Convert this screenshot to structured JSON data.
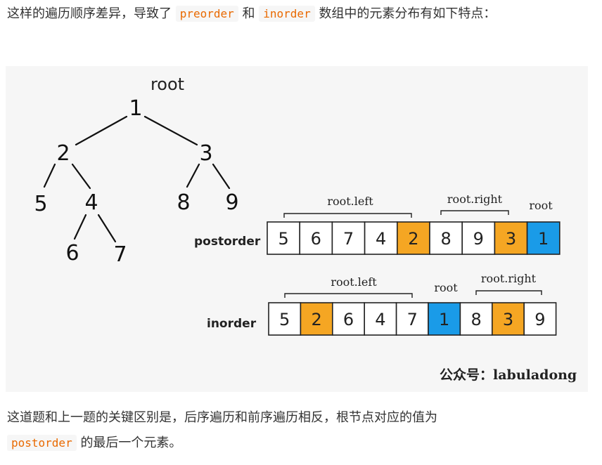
{
  "intro": {
    "part1": "这样的遍历顺序差异，导致了",
    "code1": "preorder",
    "part2": "和",
    "code2": "inorder",
    "part3": "数组中的元素分布有如下特点："
  },
  "figure": {
    "root_label": "root",
    "tree_nodes": [
      "1",
      "2",
      "3",
      "5",
      "4",
      "8",
      "9",
      "6",
      "7"
    ],
    "postorder": {
      "label": "postorder",
      "values": [
        "5",
        "6",
        "7",
        "4",
        "2",
        "8",
        "9",
        "3",
        "1"
      ],
      "highlight": [
        "",
        "",
        "",
        "",
        "orange",
        "",
        "",
        "orange",
        "blue"
      ],
      "bracket_left": "root.left",
      "bracket_right": "root.right",
      "root_tag": "root"
    },
    "inorder": {
      "label": "inorder",
      "values": [
        "5",
        "2",
        "6",
        "4",
        "7",
        "1",
        "8",
        "3",
        "9"
      ],
      "highlight": [
        "",
        "orange",
        "",
        "",
        "",
        "blue",
        "",
        "orange",
        ""
      ],
      "bracket_left": "root.left",
      "bracket_right": "root.right",
      "root_tag": "root"
    },
    "watermark": "公众号：labuladong",
    "colors": {
      "orange": "#f5a623",
      "blue": "#1a9be8",
      "background": "#f6f6f6"
    }
  },
  "outro": {
    "part1": "这道题和上一题的关键区别是，后序遍历和前序遍历相反，根节点对应的值为",
    "code1": "postorder",
    "part2": "的最后一个元素。"
  }
}
